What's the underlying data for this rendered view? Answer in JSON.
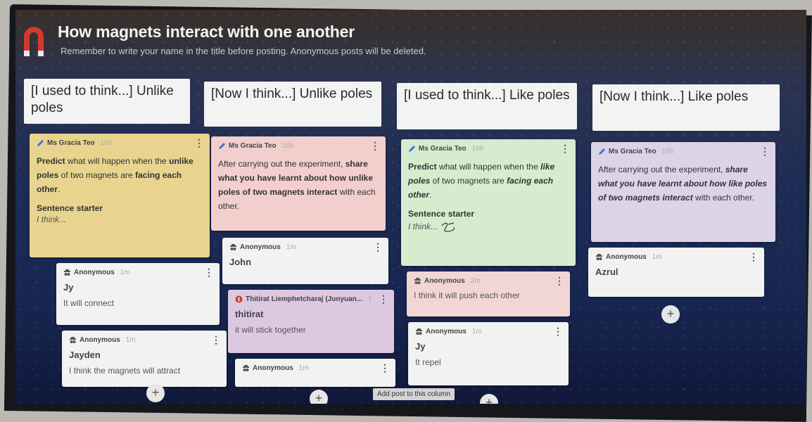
{
  "board": {
    "title": "How magnets interact with one another",
    "subtitle": "Remember to write your name in the title before posting. Anonymous posts will be deleted.",
    "add_post_tooltip": "Add post to this column"
  },
  "columns": [
    {
      "header": "[I used to think...] Unlike poles",
      "prompt": {
        "author": "Ms Gracia Teo",
        "time": "16h",
        "text_parts": [
          "Predict",
          " what will happen when the ",
          "unlike poles",
          " of two magnets are ",
          "facing each other",
          "."
        ],
        "starter_label": "Sentence starter",
        "starter_text": "I think..."
      },
      "posts": [
        {
          "author": "Anonymous",
          "time": "1m",
          "title": "Jy",
          "text": "It will connect"
        },
        {
          "author": "Anonymous",
          "time": "1m",
          "title": "Jayden",
          "text": "I think the magnets will attract"
        }
      ]
    },
    {
      "header": "[Now I think...] Unlike poles",
      "prompt": {
        "author": "Ms Gracia Teo",
        "time": "16h",
        "text_parts": [
          "After carrying out the experiment, ",
          "share what you have learnt about how unlike poles of two magnets interact",
          " with each other."
        ]
      },
      "posts": [
        {
          "author": "Anonymous",
          "time": "1m",
          "title": "John",
          "text": ""
        },
        {
          "author": "Thitirat Liemphetcharaj (Junyuan...",
          "time": "1",
          "title": "thitirat",
          "text": "it will stick together"
        },
        {
          "author": "Anonymous",
          "time": "1m",
          "title": "",
          "text": ""
        }
      ]
    },
    {
      "header": "[I used to think...] Like poles",
      "prompt": {
        "author": "Ms Gracia Teo",
        "time": "16h",
        "text_parts": [
          "Predict",
          " what will happen when the ",
          "like poles",
          " of two magnets are ",
          "facing each other",
          "."
        ],
        "starter_label": "Sentence starter",
        "starter_text": "I think..."
      },
      "posts": [
        {
          "author": "Anonymous",
          "time": "2m",
          "title": "",
          "text": "I think it will push each other"
        },
        {
          "author": "Anonymous",
          "time": "1m",
          "title": "Jy",
          "text": "It repel"
        }
      ]
    },
    {
      "header": "[Now I think...] Like poles",
      "prompt": {
        "author": "Ms Gracia Teo",
        "time": "16h",
        "text_parts": [
          "After carrying out the experiment, ",
          "share what you have learnt about how like poles of two magnets interact",
          " with each other."
        ]
      },
      "posts": [
        {
          "author": "Anonymous",
          "time": "1m",
          "title": "Azrul",
          "text": ""
        }
      ]
    }
  ],
  "colors": {
    "prompt_col1": "#e9d48f",
    "prompt_col2": "#f2cfcd",
    "prompt_col3": "#d7ebcf",
    "prompt_col4": "#dcd3e9",
    "post_default": "#f2f2f2",
    "magnet_red": "#d23a2e"
  },
  "icons": {
    "logo": "magnet-icon",
    "teacher": "pencil-icon",
    "anonymous": "anonymous-icon",
    "student": "red-avatar-icon",
    "menu": "kebab-menu-icon",
    "add": "plus-icon"
  }
}
